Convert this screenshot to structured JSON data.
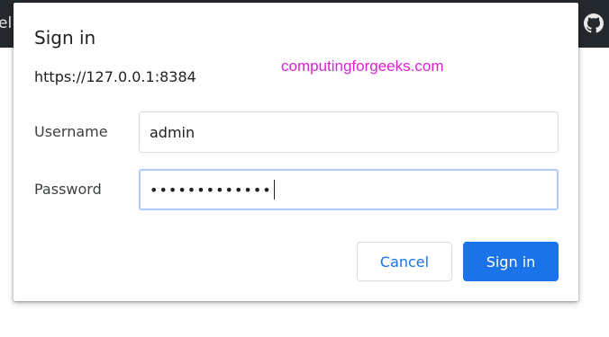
{
  "background": {
    "fragment_text": "el",
    "icon": "github-icon",
    "bar_color": "#24292e"
  },
  "dialog": {
    "title": "Sign in",
    "origin": "https://127.0.0.1:8384",
    "watermark": "computingforgeeks.com",
    "username": {
      "label": "Username",
      "value": "admin"
    },
    "password": {
      "label": "Password",
      "masked_value": "•••••••••••••"
    },
    "buttons": {
      "cancel": "Cancel",
      "sign_in": "Sign in"
    }
  },
  "colors": {
    "accent": "#1a73e8",
    "focus_ring": "#aecbfa",
    "watermark": "#e020d0"
  }
}
